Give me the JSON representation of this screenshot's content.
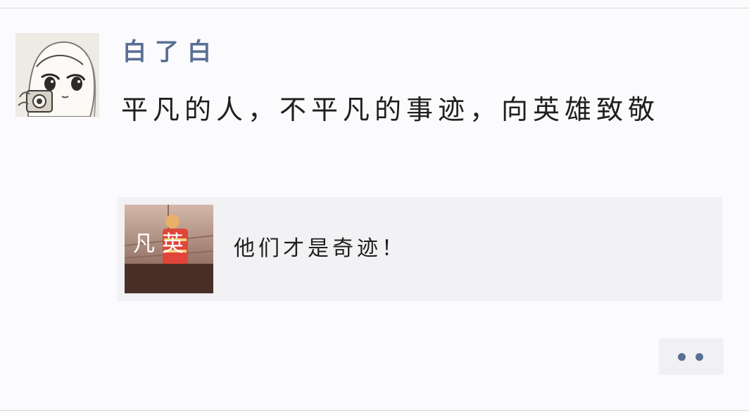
{
  "post": {
    "username": "白了白",
    "text": "平凡的人，不平凡的事迹，向英雄致敬"
  },
  "link_card": {
    "title": "他们才是奇迹！",
    "thumbnail_text": "凡 英"
  },
  "colors": {
    "background": "#fbfafc",
    "username": "#5a6f94",
    "card_background": "#f2f1f4",
    "dots": "#5a6f94"
  },
  "icons": {
    "more": "more-dots-icon"
  }
}
